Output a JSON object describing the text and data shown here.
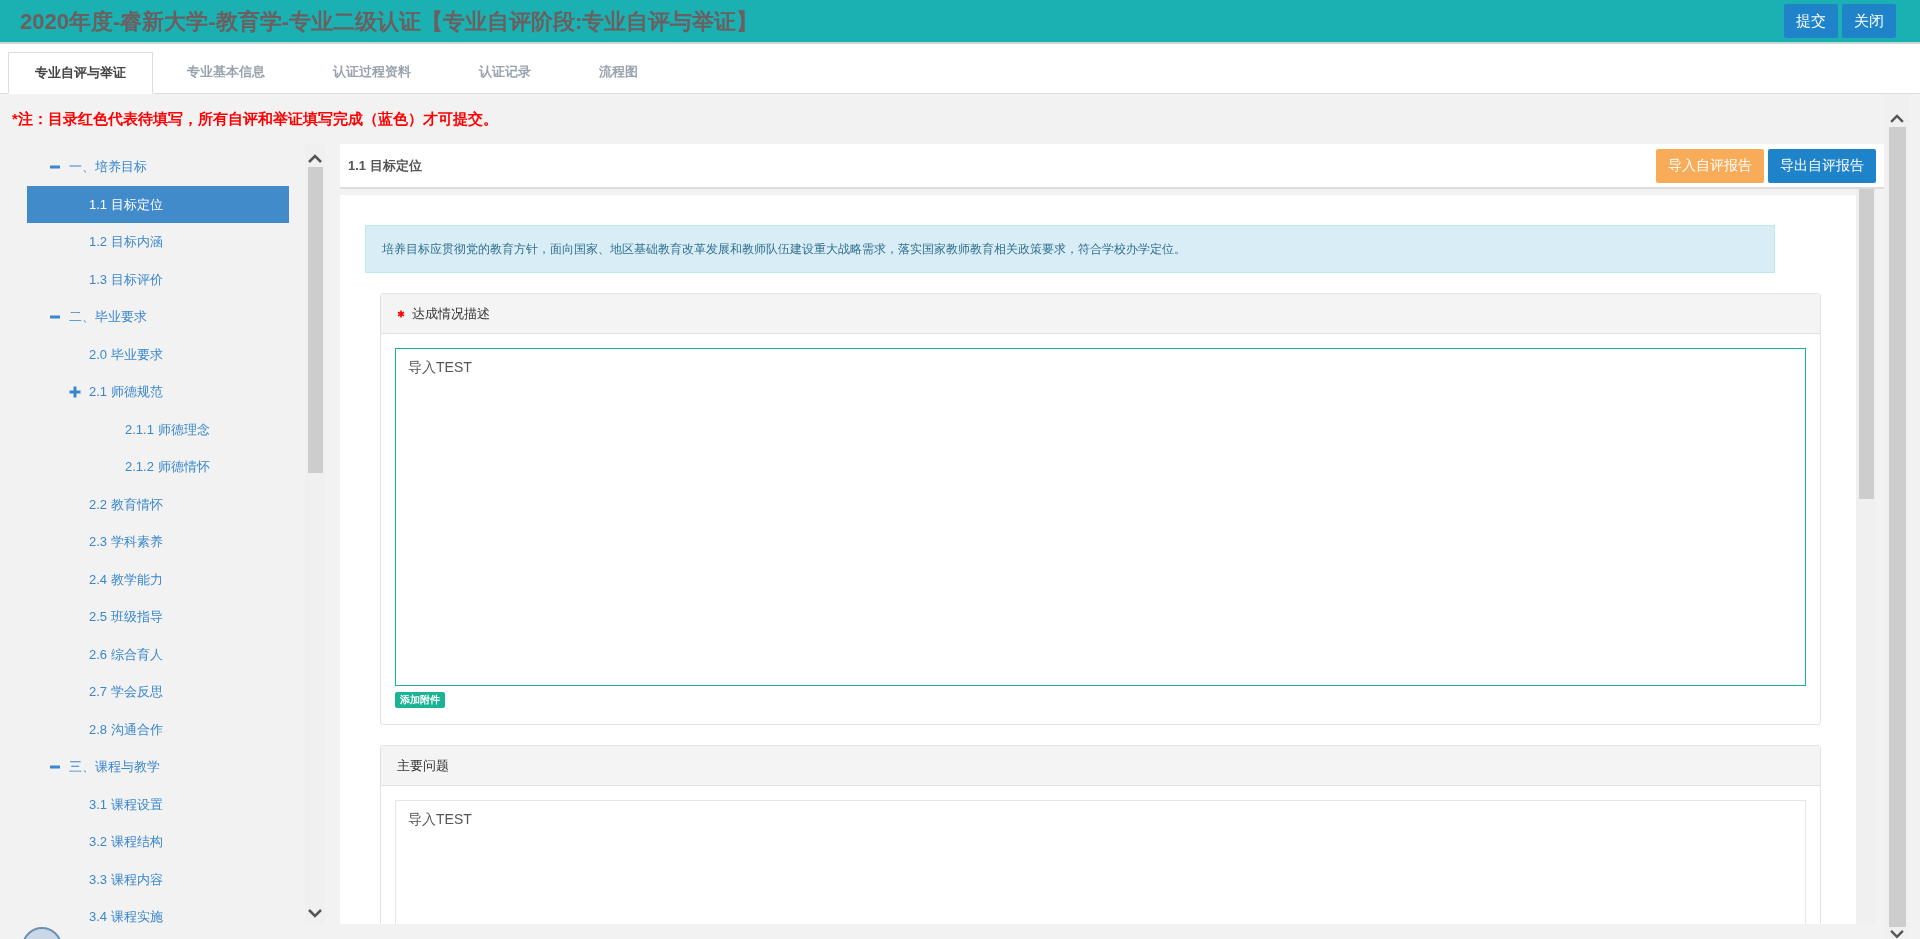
{
  "header": {
    "title": "2020年度-睿新大学-教育学-专业二级认证【专业自评阶段:专业自评与举证】",
    "buttons": [
      "提交",
      "关闭"
    ]
  },
  "tabs": [
    {
      "label": "专业自评与举证",
      "selected": true
    },
    {
      "label": "专业基本信息",
      "selected": false
    },
    {
      "label": "认证过程资料",
      "selected": false
    },
    {
      "label": "认证记录",
      "selected": false
    },
    {
      "label": "流程图",
      "selected": false
    }
  ],
  "notice": "*注：目录红色代表待填写，所有自评和举证填写完成（蓝色）才可提交。",
  "tree": [
    {
      "label": "一、培养目标",
      "expanded": true,
      "selected": false,
      "children": [
        {
          "label": "1.1 目标定位",
          "selected": true
        },
        {
          "label": "1.2 目标内涵",
          "selected": false
        },
        {
          "label": "1.3 目标评价",
          "selected": false
        }
      ]
    },
    {
      "label": "二、毕业要求",
      "expanded": true,
      "selected": false,
      "children": [
        {
          "label": "2.0 毕业要求",
          "selected": false
        },
        {
          "label": "2.1 师德规范",
          "expanded": false,
          "selected": false,
          "children": [
            {
              "label": "2.1.1 师德理念",
              "selected": false
            },
            {
              "label": "2.1.2 师德情怀",
              "selected": false
            }
          ]
        },
        {
          "label": "2.2 教育情怀",
          "selected": false
        },
        {
          "label": "2.3 学科素养",
          "selected": false
        },
        {
          "label": "2.4 教学能力",
          "selected": false
        },
        {
          "label": "2.5 班级指导",
          "selected": false
        },
        {
          "label": "2.6 综合育人",
          "selected": false
        },
        {
          "label": "2.7 学会反思",
          "selected": false
        },
        {
          "label": "2.8 沟通合作",
          "selected": false
        }
      ]
    },
    {
      "label": "三、课程与教学",
      "expanded": true,
      "selected": false,
      "children": [
        {
          "label": "3.1 课程设置",
          "selected": false
        },
        {
          "label": "3.2 课程结构",
          "selected": false
        },
        {
          "label": "3.3 课程内容",
          "selected": false
        },
        {
          "label": "3.4 课程实施",
          "selected": false
        }
      ]
    }
  ],
  "panel": {
    "title": "1.1 目标定位",
    "buttons": [
      {
        "label": "导入自评报告",
        "kind": "import"
      },
      {
        "label": "导出自评报告",
        "kind": "export"
      }
    ],
    "info": "培养目标应贯彻党的教育方针，面向国家、地区基础教育改革发展和教师队伍建设重大战略需求，落实国家教师教育相关政策要求，符合学校办学定位。",
    "sections": [
      {
        "title": "达成情况描述",
        "required": true,
        "value": "导入TEST",
        "focused": true,
        "attach_button": "添加附件"
      },
      {
        "title": "主要问题",
        "required": false,
        "value": "导入TEST",
        "focused": false
      }
    ]
  }
}
